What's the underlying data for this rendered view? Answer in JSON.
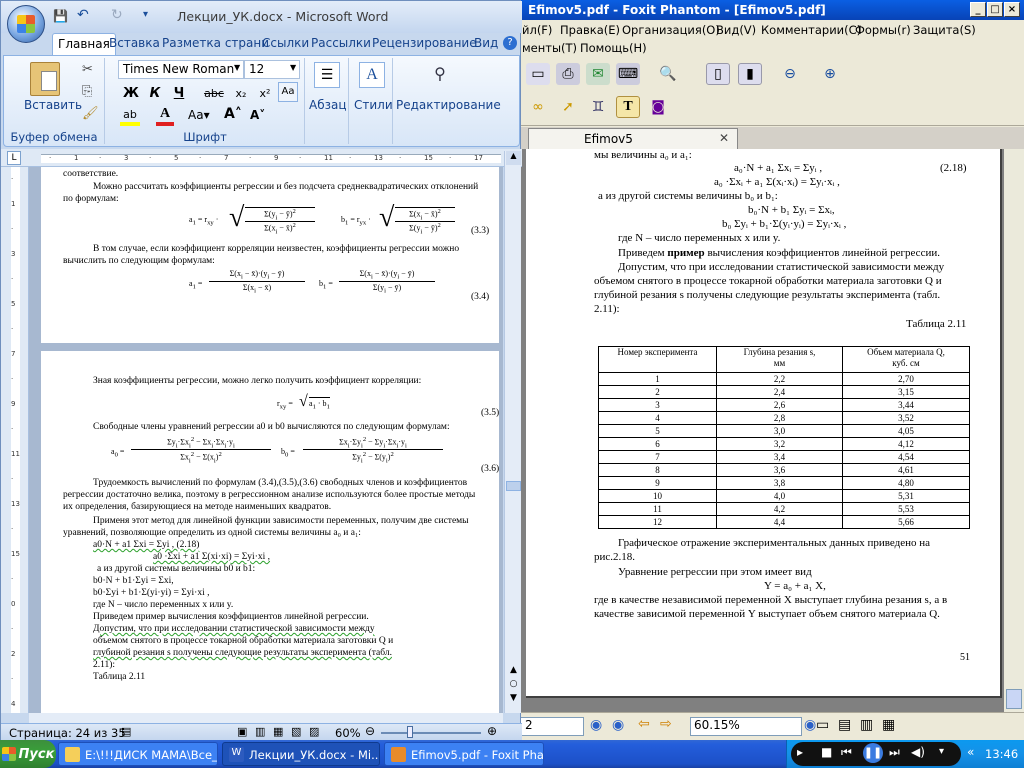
{
  "foxit": {
    "title": "Efimov5.pdf - Foxit Phantom - [Efimov5.pdf]",
    "menu_row1": [
      "йл(F)",
      "Правка(E)",
      "Организация(O)",
      "Вид(V)",
      "Комментарии(C)",
      "Формы(r)",
      "Защита(S)"
    ],
    "menu_row2": [
      "менты(T)",
      "Помощь(H)"
    ],
    "tab_label": "Efimov5",
    "zoom": "60.15%",
    "page": {
      "l1": "мы величины a₀ и a₁:",
      "l2": "a₀·N + a₁ Σxᵢ = Σyᵢ ,",
      "l2n": "(2.18)",
      "l3": "a₀ ·Σxᵢ + a₁ Σ(xᵢ·xᵢ) = Σyᵢ·xᵢ ,",
      "l4": "а из другой системы величины  b₀ и b₁:",
      "l5": "b₀·N + b₁ Σyᵢ = Σxᵢ,",
      "l6": "b₀ Σyᵢ + b₁·Σ(yᵢ·yᵢ) = Σyᵢ·xᵢ ,",
      "l7": "где N – число переменных x или y.",
      "l8a": "Приведем ",
      "l8b": "пример",
      "l8c": " вычисления коэффициентов линейной регрессии.",
      "p1": "Допустим, что при исследовании статистической зависимости между",
      "p2": "объемом снятого в процессе токарной обработки материала заготовки Q и",
      "p3": "глубиной резания  s получены следующие результаты эксперимента (табл.",
      "p4": "2.11):",
      "table_caption": "Таблица 2.11",
      "col1": "Номер эксперимента",
      "col2a": "Глубина резания s,",
      "col2b": "мм",
      "col3a": "Объем материала Q,",
      "col3b": "куб. см",
      "rows": [
        [
          "1",
          "2,2",
          "2,70"
        ],
        [
          "2",
          "2,4",
          "3,15"
        ],
        [
          "3",
          "2,6",
          "3,44"
        ],
        [
          "4",
          "2,8",
          "3,52"
        ],
        [
          "5",
          "3,0",
          "4,05"
        ],
        [
          "6",
          "3,2",
          "4,12"
        ],
        [
          "7",
          "3,4",
          "4,54"
        ],
        [
          "8",
          "3,6",
          "4,61"
        ],
        [
          "9",
          "3,8",
          "4,80"
        ],
        [
          "10",
          "4,0",
          "5,31"
        ],
        [
          "11",
          "4,2",
          "5,53"
        ],
        [
          "12",
          "4,4",
          "5,66"
        ]
      ],
      "q1": "Графическое отражение экспериментальных данных приведено на",
      "q2": "рис.2.18.",
      "q3": "Уравнение регрессии при этом имеет вид",
      "q4": "Y = a₀ + a₁ X,",
      "q5": "где в качестве независимой переменной X выступает глубина резания s, а в",
      "q6": "качестве зависимой переменной Y выступает объем снятого материала Q.",
      "page_num": "51"
    }
  },
  "word": {
    "title": "Лекции_УК.docx - Microsoft Word",
    "tabs": [
      "Главная",
      "Вставка",
      "Разметка страни",
      "Ссылки",
      "Рассылки",
      "Рецензирование",
      "Вид"
    ],
    "font_name": "Times New Roman",
    "font_size": "12",
    "groups": {
      "clipboard": "Буфер обмена",
      "font": "Шрифт",
      "paste": "Вставить",
      "paragraph": "Абзац",
      "styles": "Стили",
      "editing": "Редактирование"
    },
    "format_buttons": [
      "Ж",
      "К",
      "Ч",
      "abc",
      "x₂",
      "x²"
    ],
    "page1": {
      "t0": "соответствие.",
      "t1": "Можно рассчитать коэффициенты регрессии и без подсчета среднеквадратических отклонений",
      "t2": "по формулам:",
      "f33": "(3.3)",
      "t3": "В том случае, если коэффициент корреляции неизвестен, коэффициенты регрессии можно",
      "t4": "вычислить по следующим формулам:",
      "f34": "(3.4)"
    },
    "page2": {
      "t1": "Зная коэффициенты регрессии, можно легко получить коэффициент корреляции:",
      "f35": "(3.5)",
      "t2": "Свободные члены уравнений регрессии  a0 и b0  вычисляются по следующим формулам:",
      "f36": "(3.6)",
      "t3": "Трудоемкость вычислений по формулам (3.4),(3.5),(3.6) свободных членов и коэффициентов",
      "t4": "регрессии достаточно велика, поэтому  в регрессионном анализе используются более простые методы",
      "t5": "их определения, базирующиеся на методе наименьших квадратов.",
      "t6": "Применя  этот метод для  линейной функции зависимости переменных, получим две системы",
      "t7": "уравнений, позволяющие  определить  из одной системы величины a₀ и a₁:",
      "t8": "a0·N + a1 Σxi = Σyi ,       (2.18)",
      "t9": "a0 ·Σxi  + a1 Σ(xi·xi) = Σyi·xi ,",
      "t10": "а из другой системы величины  b0 и b1:",
      "t11": "b0·N + b1·Σyi = Σxi,",
      "t12": "b0·Σyi + b1·Σ(yi·yi) = Σyi·xi ,",
      "t13": "где N – число переменных x или y.",
      "t14": "Приведем пример вычисления коэффициентов линейной регрессии.",
      "t15": "Допустим, что при исследовании статистической зависимости между",
      "t16": "объемом снятого в процессе токарной обработки материала заготовки Q и",
      "t17": "глубиной резания  s получены следующие результаты эксперимента (табл.",
      "t18": "2.11):",
      "t19": "Таблица 2.11"
    },
    "status_page": "Страница: 24 из 35",
    "zoom": "60%"
  },
  "taskbar": {
    "start": "Пуск",
    "items": [
      "E:\\!!!ДИСК МАМА\\Все_...",
      "Лекции_УК.docx - Mi...",
      "Efimov5.pdf - Foxit Phan..."
    ],
    "clock": "13:46"
  }
}
